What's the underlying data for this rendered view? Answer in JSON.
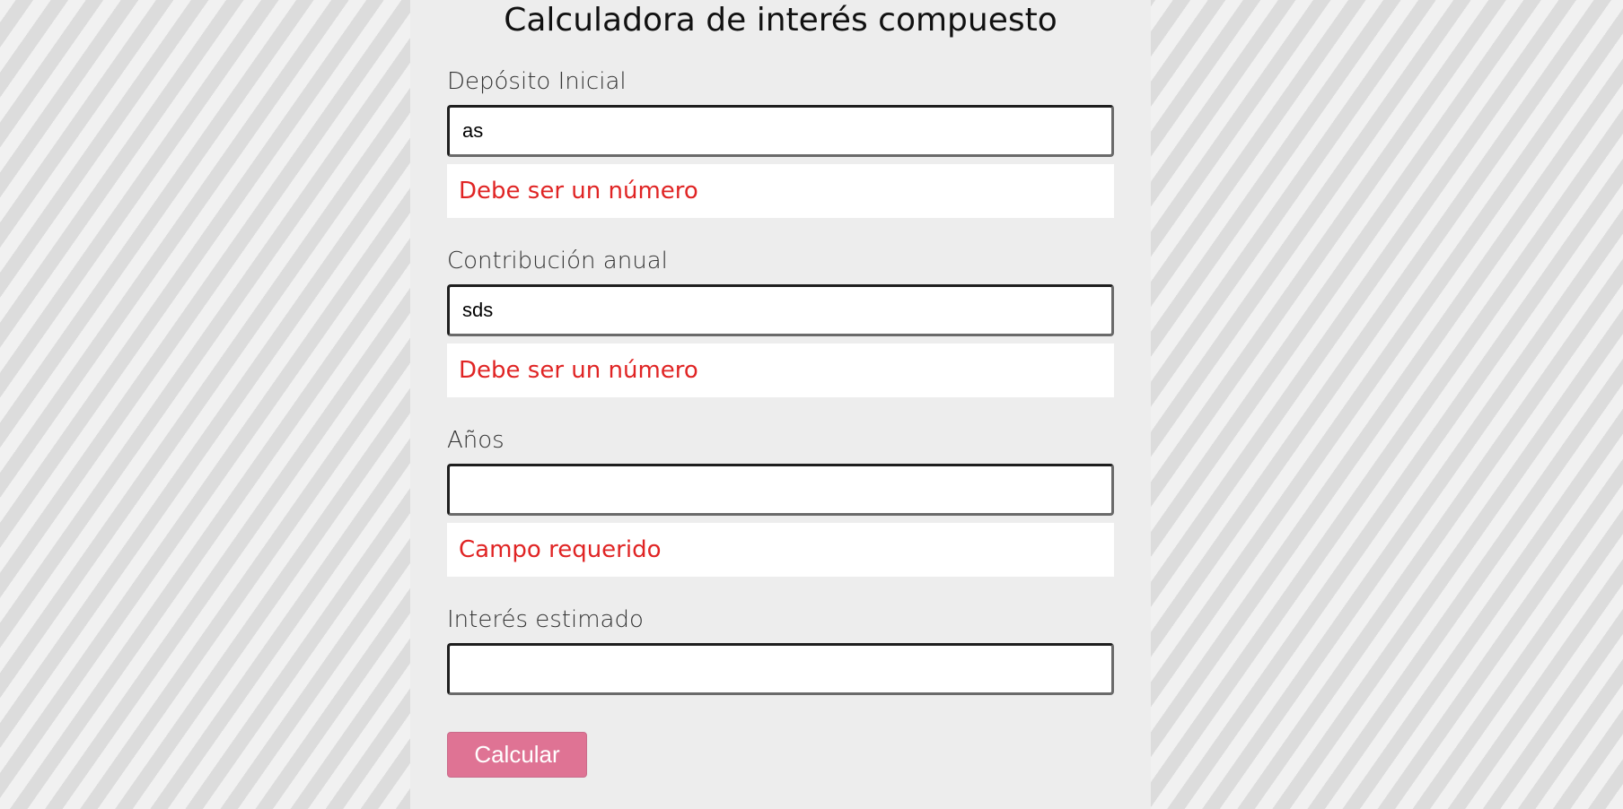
{
  "colors": {
    "panel_background": "#ededed",
    "error_text": "#e02424",
    "button_background": "#df7394",
    "button_text": "#ffffff"
  },
  "form": {
    "title": "Calculadora de interés compuesto",
    "fields": [
      {
        "label": "Depósito Inicial",
        "value": "as",
        "error": "Debe ser un número"
      },
      {
        "label": "Contribución anual",
        "value": "sds",
        "error": "Debe ser un número"
      },
      {
        "label": "Años",
        "value": "",
        "error": "Campo requerido"
      },
      {
        "label": "Interés estimado",
        "value": ""
      }
    ],
    "submit_label": "Calcular"
  }
}
